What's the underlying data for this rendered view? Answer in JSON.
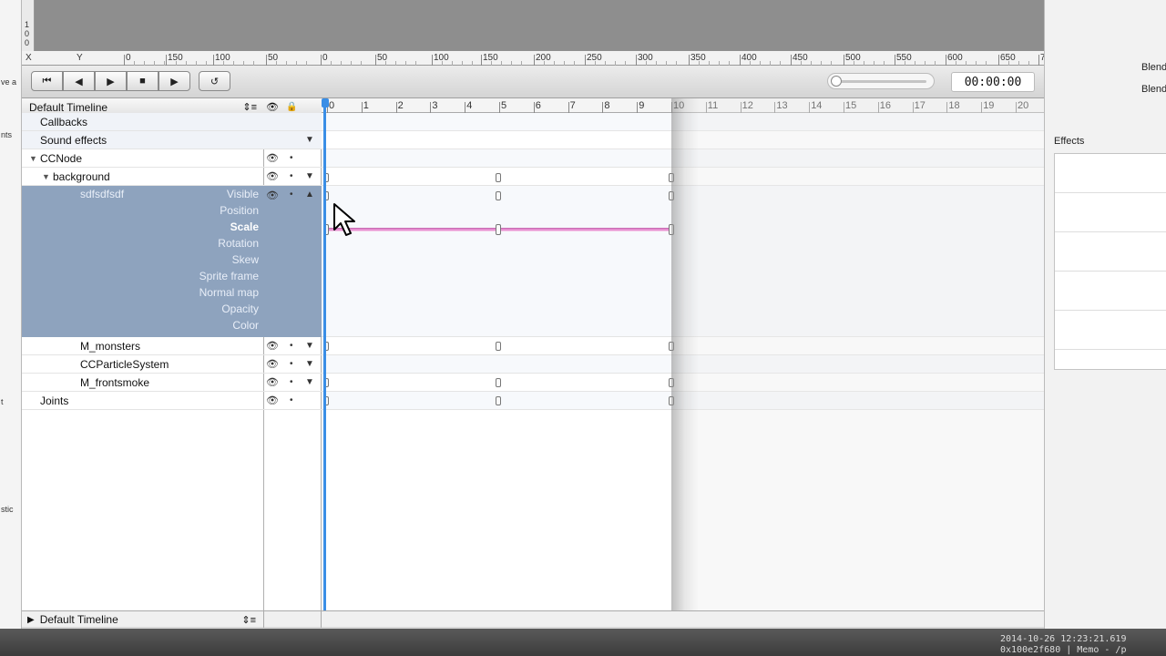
{
  "left_strip": {
    "items": [
      "ve a",
      "nts",
      "t",
      "stic"
    ]
  },
  "canvas": {
    "vertical_ruler": [
      "1",
      "0",
      "0"
    ]
  },
  "ruler": {
    "axis_x": "X",
    "axis_y": "Y",
    "labels": [
      "0",
      "150",
      "100",
      "50",
      "0",
      "50",
      "100",
      "150",
      "200",
      "250",
      "300",
      "350",
      "400",
      "450",
      "500",
      "550",
      "600",
      "650",
      "7"
    ]
  },
  "toolbar": {
    "buttons": [
      {
        "name": "skip-to-start",
        "glyph": "⏮"
      },
      {
        "name": "step-back",
        "glyph": "◀"
      },
      {
        "name": "step-forward",
        "glyph": "▶"
      },
      {
        "name": "stop",
        "glyph": "■"
      },
      {
        "name": "play",
        "glyph": "▶"
      },
      {
        "name": "loop",
        "glyph": "↺"
      }
    ],
    "timecode": "00:00:00",
    "zoom_fraction": 0.0
  },
  "timeline": {
    "header": "Default Timeline",
    "header_icon": "⇕≡",
    "eye_icon": "👁",
    "lock_icon": "🔒",
    "ruler_labels": [
      "0",
      "1",
      "2",
      "3",
      "4",
      "5",
      "6",
      "7",
      "8",
      "9",
      "10",
      "11",
      "12",
      "13",
      "14",
      "15",
      "16",
      "17",
      "18",
      "19",
      "20"
    ],
    "rows": [
      {
        "label": "Callbacks",
        "indent": 0,
        "type": "plain"
      },
      {
        "label": "Sound effects",
        "indent": 0,
        "type": "plain",
        "menu": "▼"
      },
      {
        "label": "CCNode",
        "indent": 0,
        "type": "node",
        "disclosure": "▼",
        "eye": "👁",
        "dot": "•"
      },
      {
        "label": "background",
        "indent": 1,
        "type": "node",
        "disclosure": "▼",
        "eye": "👁",
        "dot": "•",
        "menu": "▼"
      },
      {
        "label": "sdfsdfsdf",
        "indent": 2,
        "type": "selected",
        "eye": "👁",
        "dot": "•",
        "menu": "▲"
      },
      {
        "label": "M_monsters",
        "indent": 2,
        "type": "node",
        "eye": "👁",
        "dot": "•",
        "menu": "▼"
      },
      {
        "label": "CCParticleSystem",
        "indent": 2,
        "type": "node",
        "eye": "👁",
        "dot": "•",
        "menu": "▼"
      },
      {
        "label": "M_frontsmoke",
        "indent": 2,
        "type": "node",
        "eye": "👁",
        "dot": "•",
        "menu": "▼"
      },
      {
        "label": "Joints",
        "indent": 0,
        "type": "node",
        "eye": "👁",
        "dot": "•"
      }
    ],
    "properties": [
      "Visible",
      "Position",
      "Scale",
      "Rotation",
      "Skew",
      "Sprite frame",
      "Normal map",
      "Opacity",
      "Color"
    ],
    "active_property": "Scale",
    "footer_label": "Default Timeline",
    "footer_icon": "⇕≡",
    "footer_disclosure": "▶"
  },
  "right_panel": {
    "labels": [
      "Blend",
      "Blend"
    ],
    "effects_label": "Effects"
  },
  "status": {
    "line1": "2014-10-26 12:23:21.619",
    "line2": "0x100e2f680 | Memo - /p"
  },
  "colors": {
    "selection": "#8ea3be",
    "scale_track": "#e68fd0",
    "playhead": "#3a8ee6"
  }
}
